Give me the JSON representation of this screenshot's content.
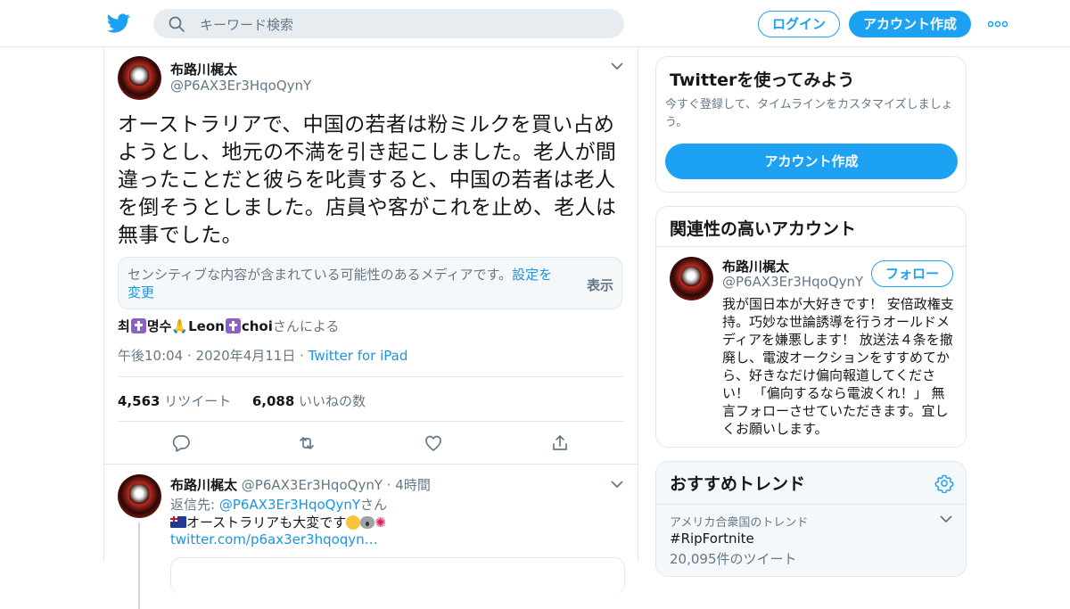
{
  "header": {
    "search_placeholder": "キーワード検索",
    "login_label": "ログイン",
    "signup_label": "アカウント作成"
  },
  "tweet": {
    "author_name": "布路川梶太",
    "author_handle": "@P6AX3Er3HqoQynY",
    "text": "オーストラリアで、中国の若者は粉ミルクを買い占めようとし、地元の不満を引き起こしました。老人が間違ったことだと彼らを叱責すると、中国の若者は老人を倒そうとしました。店員や客がこれを止め、老人は無事でした。",
    "sensitive_text": "センシティブな内容が含まれている可能性のあるメディアです。",
    "sensitive_link": "設定を変更",
    "sensitive_show": "表示",
    "via_name_1": "최",
    "via_name_2": "명수",
    "via_name_3": "Leon",
    "via_name_4": "choi",
    "via_suffix": "さんによる",
    "timestamp": "午後10:04 · 2020年4月11日",
    "separator": " · ",
    "client": "Twitter for iPad",
    "retweet_count": "4,563",
    "retweet_label": "リツイート",
    "like_count": "6,088",
    "like_label": "いいねの数"
  },
  "reply": {
    "author_name": "布路川梶太",
    "author_handle": "@P6AX3Er3HqoQynY",
    "time": " · 4時間",
    "reply_prefix": "返信先: ",
    "reply_handle": "@P6AX3Er3HqoQynY",
    "reply_suffix": "さん",
    "text": "オーストラリアも大変です",
    "link": "twitter.com/p6ax3er3hqoqyn…"
  },
  "sidebar": {
    "signup_card": {
      "title": "Twitterを使ってみよう",
      "subtitle": "今すぐ登録して、タイムラインをカスタマイズしましょう。",
      "button": "アカウント作成"
    },
    "related_card": {
      "title": "関連性の高いアカウント",
      "name": "布路川梶太",
      "handle": "@P6AX3Er3HqoQynY",
      "follow_label": "フォロー",
      "bio": "我が国日本が大好きです！ 安倍政権支持。巧妙な世論誘導を行うオールドメディアを嫌悪します！ 放送法４条を撤廃し、電波オークションをすすめてから、好きなだけ偏向報道してください！ 「偏向するなら電波くれ！」 無言フォローさせていただきます。宜しくお願いします。"
    },
    "trends_card": {
      "title": "おすすめトレンド",
      "context": "アメリカ合衆国のトレンド",
      "trend": "#RipFortnite",
      "count": "20,095件のツイート"
    }
  },
  "colors": {
    "accent": "#1da1f2",
    "link": "#1b95e0",
    "muted": "#657786",
    "border": "#e1e8ed"
  },
  "icons": [
    "twitter-bird-icon",
    "search-icon",
    "more-icon",
    "chevron-down-icon",
    "reply-icon",
    "retweet-icon",
    "like-icon",
    "share-icon",
    "gear-icon"
  ]
}
